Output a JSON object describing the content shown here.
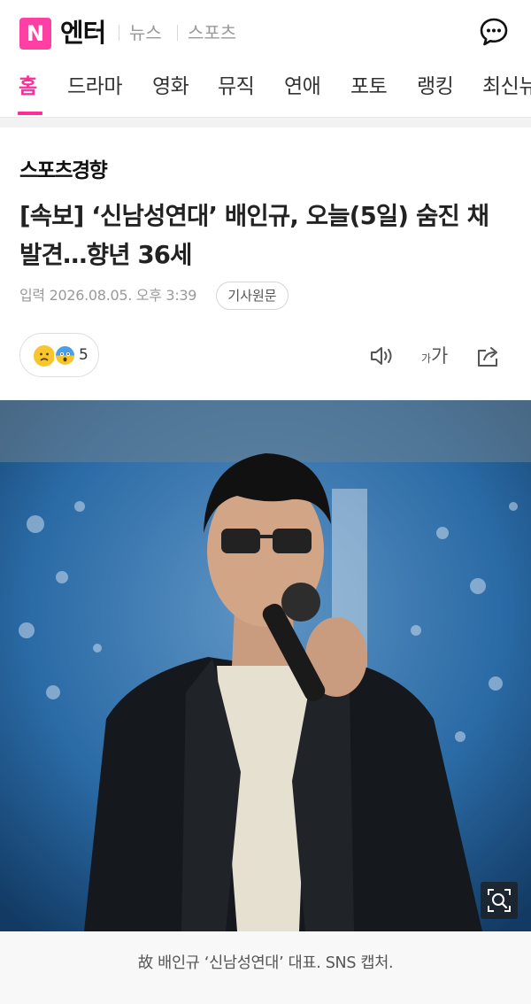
{
  "header": {
    "logo_letter": "N",
    "brand": "엔터",
    "links": [
      "뉴스",
      "스포츠"
    ]
  },
  "categories": {
    "items": [
      "홈",
      "드라마",
      "영화",
      "뮤직",
      "연애",
      "포토",
      "랭킹",
      "최신뉴스"
    ],
    "active_index": 0
  },
  "article": {
    "press": "스포츠경향",
    "headline": "[속보] ‘신남성연대’ 배인규, 오늘(5일) 숨진 채 발견…향년 36세",
    "date": "입력 2026.08.05. 오후 3:39",
    "original_button": "기사원문",
    "reaction_count": "5",
    "font_size_small": "가",
    "font_size_big": "가",
    "caption": "故 배인규 ‘신남성연대’ 대표. SNS 캡처."
  },
  "icons": {
    "chat": "chat-bubble-icon",
    "speaker": "speaker-icon",
    "share": "share-icon",
    "zoom": "zoom-search-icon",
    "reactions": [
      "sad-face-icon",
      "shocked-face-icon"
    ]
  },
  "colors": {
    "accent": "#ff2d9a",
    "logo_bg": "#ff3fa4"
  }
}
